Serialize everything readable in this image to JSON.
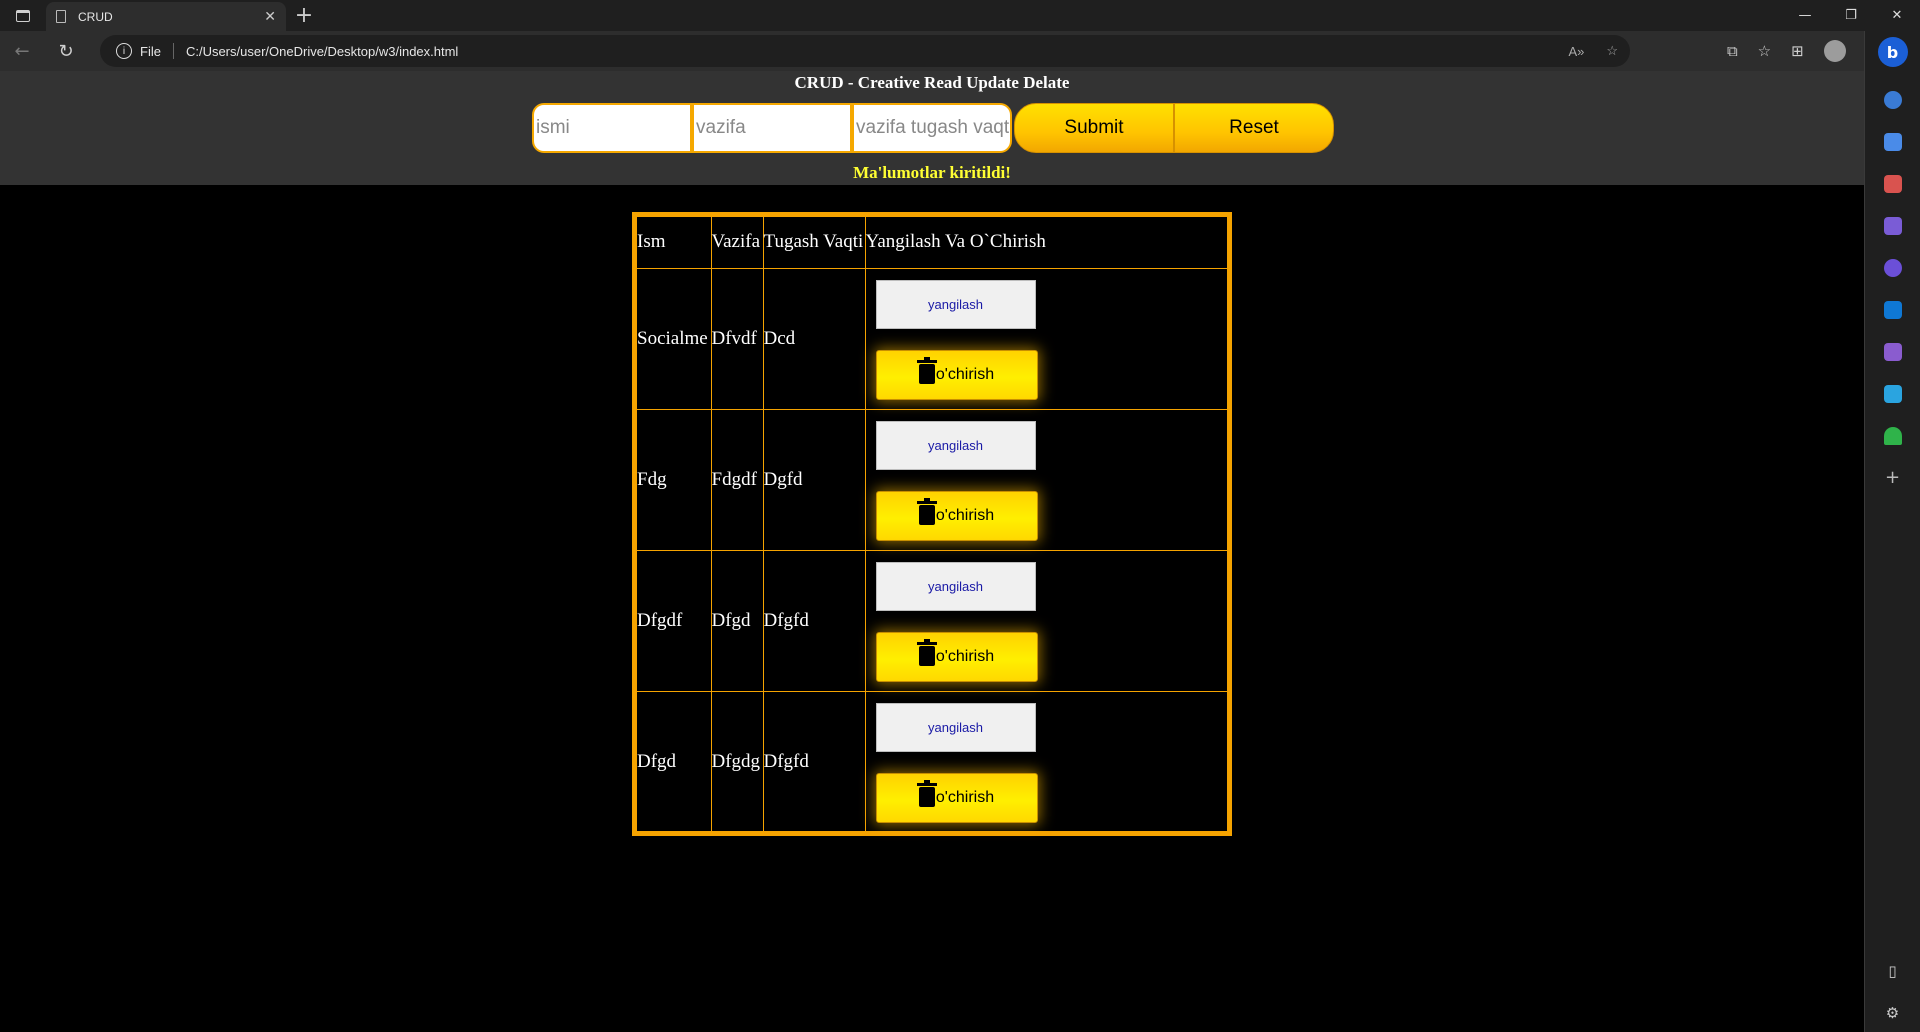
{
  "browser": {
    "tab_title": "CRUD",
    "file_label": "File",
    "url": "C:/Users/user/OneDrive/Desktop/w3/index.html",
    "bing_label": "b"
  },
  "page": {
    "title": "CRUD - Creative Read Update Delate",
    "form": {
      "name_placeholder": "ismi",
      "task_placeholder": "vazifa",
      "deadline_placeholder": "vazifa tugash vaqti",
      "submit_label": "Submit",
      "reset_label": "Reset"
    },
    "status_message": "Ma'lumotlar kiritildi!",
    "table": {
      "headers": [
        "Ism",
        "Vazifa",
        "Tugash Vaqti",
        "Yangilash Va O`Chirish"
      ],
      "update_label": "yangilash",
      "delete_label": "o'chirish",
      "rows": [
        {
          "ism": "Socialme",
          "vazifa": "Dfvdf",
          "vaqt": "Dcd"
        },
        {
          "ism": "Fdg",
          "vazifa": "Fdgdf",
          "vaqt": "Dgfd"
        },
        {
          "ism": "Dfgdf",
          "vazifa": "Dfgd",
          "vaqt": "Dfgfd"
        },
        {
          "ism": "Dfgd",
          "vazifa": "Dfgdg",
          "vaqt": "Dfgfd"
        }
      ]
    }
  }
}
